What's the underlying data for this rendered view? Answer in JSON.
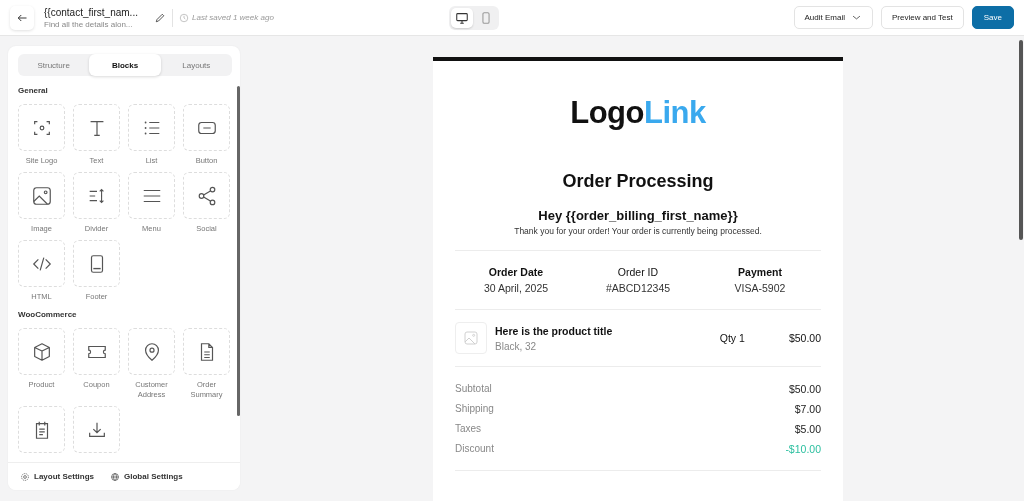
{
  "topbar": {
    "title": "{{contact_first_nam...",
    "subtitle": "Find all the details alon...",
    "last_saved": "Last saved 1 week ago",
    "devices": [
      {
        "kind": "desktop",
        "selected": true
      },
      {
        "kind": "mobile",
        "selected": false
      }
    ],
    "audit_button": "Audit Email",
    "preview_button": "Preview and Test",
    "save_button": "Save"
  },
  "sidebar": {
    "tabs": [
      {
        "label": "Structure",
        "selected": false
      },
      {
        "label": "Blocks",
        "selected": true
      },
      {
        "label": "Layouts",
        "selected": false
      }
    ],
    "sections": [
      {
        "title": "General",
        "blocks": [
          {
            "label": "Site Logo",
            "kind": "logo"
          },
          {
            "label": "Text",
            "kind": "text"
          },
          {
            "label": "List",
            "kind": "list"
          },
          {
            "label": "Button",
            "kind": "button"
          },
          {
            "label": "Image",
            "kind": "image"
          },
          {
            "label": "Divider",
            "kind": "divider"
          },
          {
            "label": "Menu",
            "kind": "menu"
          },
          {
            "label": "Social",
            "kind": "social"
          },
          {
            "label": "HTML",
            "kind": "html"
          },
          {
            "label": "Footer",
            "kind": "footer"
          }
        ]
      },
      {
        "title": "WooCommerce",
        "blocks": [
          {
            "label": "Product",
            "kind": "product"
          },
          {
            "label": "Coupon",
            "kind": "coupon"
          },
          {
            "label": "Customer Address",
            "kind": "address"
          },
          {
            "label": "Order Summary",
            "kind": "summary"
          },
          {
            "kind": "notes"
          },
          {
            "kind": "download"
          }
        ]
      }
    ],
    "footer_links": [
      "Layout Settings",
      "Global Settings"
    ]
  },
  "email": {
    "logo": [
      {
        "text": "Logo",
        "accent": false
      },
      {
        "text": "Link",
        "accent": true
      }
    ],
    "heading": "Order Processing",
    "greeting": "Hey {{order_billing_first_name}}",
    "message": "Thank you for your order! Your order is currently being processed.",
    "info": [
      {
        "label": "Order Date",
        "value": "30 April, 2025",
        "bold": true
      },
      {
        "label": "Order ID",
        "value": "#ABCD12345",
        "bold": false
      },
      {
        "label": "Payment",
        "value": "VISA-5902",
        "bold": true
      }
    ],
    "product": {
      "title": "Here is the product title",
      "variant": "Black, 32",
      "quantity": "Qty 1",
      "price": "$50.00"
    },
    "totals": [
      {
        "label": "Subtotal",
        "value": "$50.00",
        "kind": "charge"
      },
      {
        "label": "Shipping",
        "value": "$7.00",
        "kind": "charge"
      },
      {
        "label": "Taxes",
        "value": "$5.00",
        "kind": "charge"
      },
      {
        "label": "Discount",
        "value": "-$10.00",
        "kind": "discount"
      }
    ]
  }
}
